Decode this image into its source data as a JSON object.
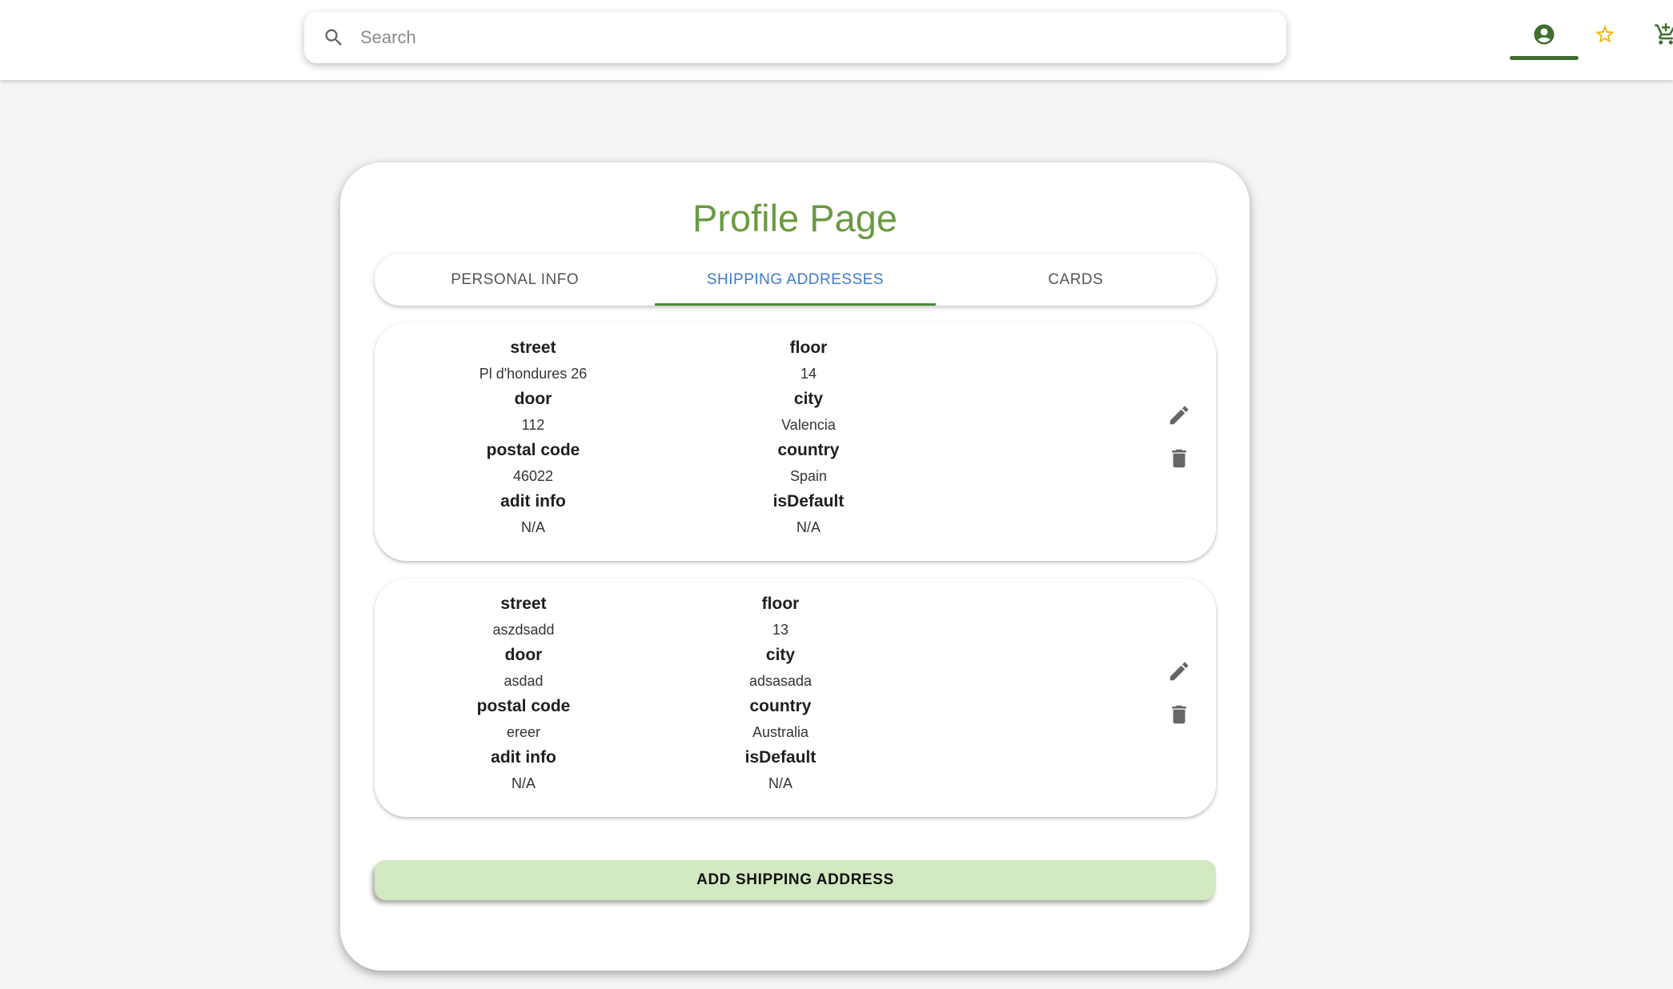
{
  "header": {
    "search": {
      "placeholder": "Search",
      "value": ""
    },
    "nav": {
      "account_icon": "account-circle-icon",
      "favorites_icon": "star-outline-icon",
      "cart_icon": "cart-icon"
    }
  },
  "colors": {
    "brand_green": "#6a9a42",
    "tab_active": "#3d7bc9",
    "button_bg": "#d2e8c0",
    "favorites_star": "#f0b400"
  },
  "profile": {
    "title": "Profile Page",
    "tabs": [
      {
        "label": "PERSONAL INFO",
        "active": false
      },
      {
        "label": "SHIPPING ADDRESSES",
        "active": true
      },
      {
        "label": "CARDS",
        "active": false
      }
    ],
    "addresses": [
      {
        "street_label": "street",
        "street": "Pl d'hondures 26",
        "floor_label": "floor",
        "floor": "14",
        "door_label": "door",
        "door": "112",
        "city_label": "city",
        "city": "Valencia",
        "postal_code_label": "postal code",
        "postal_code": "46022",
        "country_label": "country",
        "country": "Spain",
        "adit_info_label": "adit info",
        "adit_info": "N/A",
        "is_default_label": "isDefault",
        "is_default": "N/A",
        "edit_icon": "pencil-icon",
        "delete_icon": "trash-icon"
      },
      {
        "street_label": "street",
        "street": "aszdsadd",
        "floor_label": "floor",
        "floor": "13",
        "door_label": "door",
        "door": "asdad",
        "city_label": "city",
        "city": "adsasada",
        "postal_code_label": "postal code",
        "postal_code": "ereer",
        "country_label": "country",
        "country": "Australia",
        "adit_info_label": "adit info",
        "adit_info": "N/A",
        "is_default_label": "isDefault",
        "is_default": "N/A",
        "edit_icon": "pencil-icon",
        "delete_icon": "trash-icon"
      }
    ],
    "add_button_label": "ADD SHIPPING ADDRESS"
  }
}
